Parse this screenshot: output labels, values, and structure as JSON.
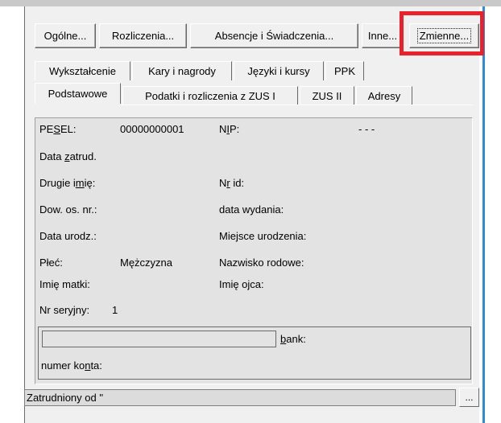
{
  "buttons": {
    "general": "Ogólne...",
    "settlements": "Rozliczenia...",
    "absences": "Absencje i Świadczenia...",
    "other": "Inne...",
    "variables": "Zmienne..."
  },
  "tabs_row1": [
    "Wykształcenie",
    "Kary i nagrody",
    "Języki i kursy",
    "PPK"
  ],
  "tabs_row2": [
    "Podstawowe",
    "Podatki i rozliczenia z ZUS I",
    "ZUS II",
    "Adresy"
  ],
  "fields": {
    "pesel_label_pre": "PE",
    "pesel_label_u": "S",
    "pesel_label_post": "EL:",
    "pesel_value": "00000000001",
    "nip_label_pre": "N",
    "nip_label_u": "I",
    "nip_label_post": "P:",
    "nip_value": "- - -",
    "hire_date_pre": "Data ",
    "hire_date_u": "z",
    "hire_date_post": "atrud.",
    "second_name_pre": "Drugie i",
    "second_name_u": "m",
    "second_name_post": "ię:",
    "id_no_pre": "N",
    "id_no_u": "r",
    "id_no_post": " id:",
    "id_doc_label": "Dow. os. nr.:",
    "issue_date_label": "data wydania:",
    "birth_date_label": "Data urodz.:",
    "birth_place_label": "Miejsce urodzenia:",
    "sex_label": "Płeć:",
    "sex_value": "Mężczyzna",
    "family_name_label": "Nazwisko rodowe:",
    "mother_name_label": "Imię matki:",
    "father_name_label": "Imię ojca:",
    "serial_label": "Nr seryjny:",
    "serial_value": "1",
    "bank_label_u": "b",
    "bank_label_post": "ank:",
    "account_label_pre": "numer ko",
    "account_label_u": "n",
    "account_label_post": "ta:"
  },
  "status_text": "Zatrudniony od \"",
  "dots_label": "..."
}
